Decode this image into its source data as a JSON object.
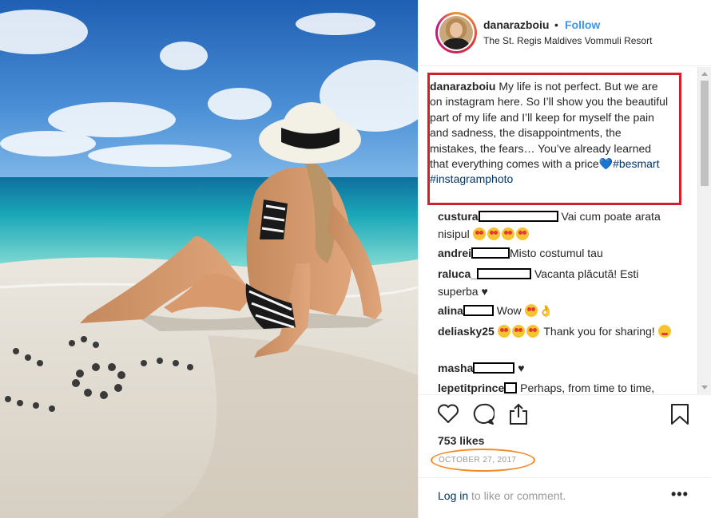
{
  "post": {
    "username": "danarazboiu",
    "separator": "•",
    "follow_label": "Follow",
    "location": "The St. Regis Maldives Vommuli Resort",
    "caption": {
      "username": "danarazboiu",
      "text": "My life is not perfect. But we are on instagram here. So I’ll show you the beautiful part of my life and I’ll keep for myself the pain and sadness, the disappointments, the mistakes, the fears… You’ve already learned that everything comes with a price",
      "heart": "💙",
      "hashtag1": "#besmart",
      "hashtag2": "#instagramphoto"
    },
    "comments": [
      {
        "user": "custura",
        "text": "Vai cum poate arata nisipul"
      },
      {
        "user": "andrei",
        "text": "Misto costumul tau"
      },
      {
        "user": "raluca_",
        "text": "Vacanta plăcută! Esti superba"
      },
      {
        "user": "alina",
        "text": "Wow"
      },
      {
        "user": "deliasky25",
        "text": "Thank you for sharing!"
      },
      {
        "user": "masha",
        "text": "♥"
      },
      {
        "user": "lepetitprince",
        "text": "Perhaps, from time to time,"
      }
    ],
    "likes": "753 likes",
    "date": "OCTOBER 27, 2017",
    "login_link": "Log in",
    "login_rest": " to like or comment.",
    "more": "•••"
  },
  "icons": [
    "heart-icon",
    "comment-icon",
    "share-icon",
    "bookmark-icon",
    "more-options-icon"
  ],
  "colors": {
    "follow": "#3897f0",
    "highlight_box": "#d0202e",
    "date_oval": "#f28a2a",
    "hashtag": "#003569"
  }
}
